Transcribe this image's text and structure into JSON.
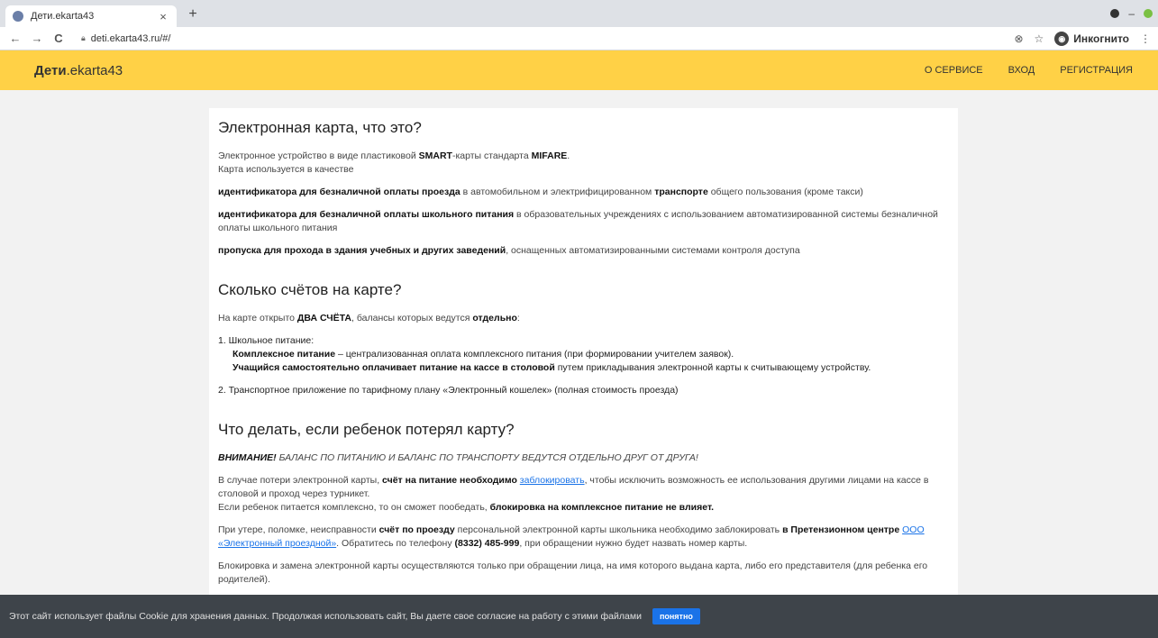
{
  "browser": {
    "tab_title": "Дети.ekarta43",
    "tab_close": "×",
    "new_tab": "+",
    "url": "deti.ekarta43.ru/#/",
    "incognito": "Инкогнито",
    "back": "←",
    "forward": "→",
    "reload": "C",
    "star": "☆",
    "ext": "⊗",
    "menu": "⋮"
  },
  "header": {
    "brand_bold": "Дети",
    "brand_rest": ".ekarta43",
    "nav": [
      "О СЕРВИСЕ",
      "ВХОД",
      "РЕГИСТРАЦИЯ"
    ]
  },
  "section1": {
    "title": "Электронная карта, что это?",
    "p1_a": "Электронное устройство в виде пластиковой ",
    "p1_b": "SMART",
    "p1_c": "-карты стандарта ",
    "p1_d": "MIFARE",
    "p1_e": ".",
    "p1_line2": "Карта используется в качестве",
    "i1_b": "идентификатора для безналичной оплаты проезда",
    "i1_t": " в автомобильном и электрифицированном ",
    "i1_b2": "транспорте",
    "i1_t2": " общего пользования (кроме такси)",
    "i2_b": "идентификатора для безналичной оплаты школьного питания",
    "i2_t": " в образовательных учреждениях с использованием автоматизированной системы безналичной оплаты школьного питания",
    "i3_b": "пропуска для прохода в здания учебных и других заведений",
    "i3_t": ", оснащенных автоматизированными системами контроля доступа"
  },
  "section2": {
    "title": "Сколько счётов на карте?",
    "p_a": "На карте открыто ",
    "p_b": "ДВА СЧЁТА",
    "p_c": ", балансы которых ведутся ",
    "p_d": "отдельно",
    "p_e": ":",
    "item1": "1. Школьное питание:",
    "item1_a_b": "Комплексное питание",
    "item1_a_t": " – централизованная оплата комплексного питания (при формировании учителем заявок).",
    "item1_b_b": "Учащийся самостоятельно оплачивает питание на кассе в столовой",
    "item1_b_t": " путем прикладывания электронной карты к считывающему устройству.",
    "item2": "2. Транспортное приложение по тарифному плану «Электронный кошелек» (полная стоимость проезда)"
  },
  "section3": {
    "title": "Что делать, если ребенок потерял карту?",
    "warn_b": "ВНИМАНИЕ!",
    "warn_t": " БАЛАНС ПО ПИТАНИЮ И БАЛАНС ПО ТРАНСПОРТУ ВЕДУТСЯ ОТДЕЛЬНО ДРУГ ОТ ДРУГА!",
    "p1_a": "В случае потери электронной карты, ",
    "p1_b": "счёт на питание необходимо ",
    "p1_link": "заблокировать",
    "p1_c": ", чтобы исключить возможность ее использования другими лицами на кассе в столовой и проход через турникет.",
    "p1_line2_a": "Если ребенок питается комплексно, то он сможет пообедать, ",
    "p1_line2_b": "блокировка на комплексное питание не влияет.",
    "p2_a": "При утере, поломке, неисправности ",
    "p2_b": "счёт по проезду",
    "p2_c": " персональной электронной карты школьника необходимо заблокировать ",
    "p2_d": "в Претензионном центре ",
    "p2_link": "ООО «Электронный проездной»",
    "p2_e": ". Обратитесь по телефону ",
    "p2_phone": "(8332) 485-999",
    "p2_f": ", при обращении нужно будет назвать номер карты.",
    "p3": "Блокировка и замена электронной карты осуществляются только при обращении лица, на имя которого выдана карта, либо его представителя (для ребенка его родителей)."
  },
  "cookie": {
    "text": "Этот сайт использует файлы Cookie для хранения данных. Продолжая использовать сайт, Вы даете свое согласие на работу с этими файлами",
    "button": "понятно"
  }
}
